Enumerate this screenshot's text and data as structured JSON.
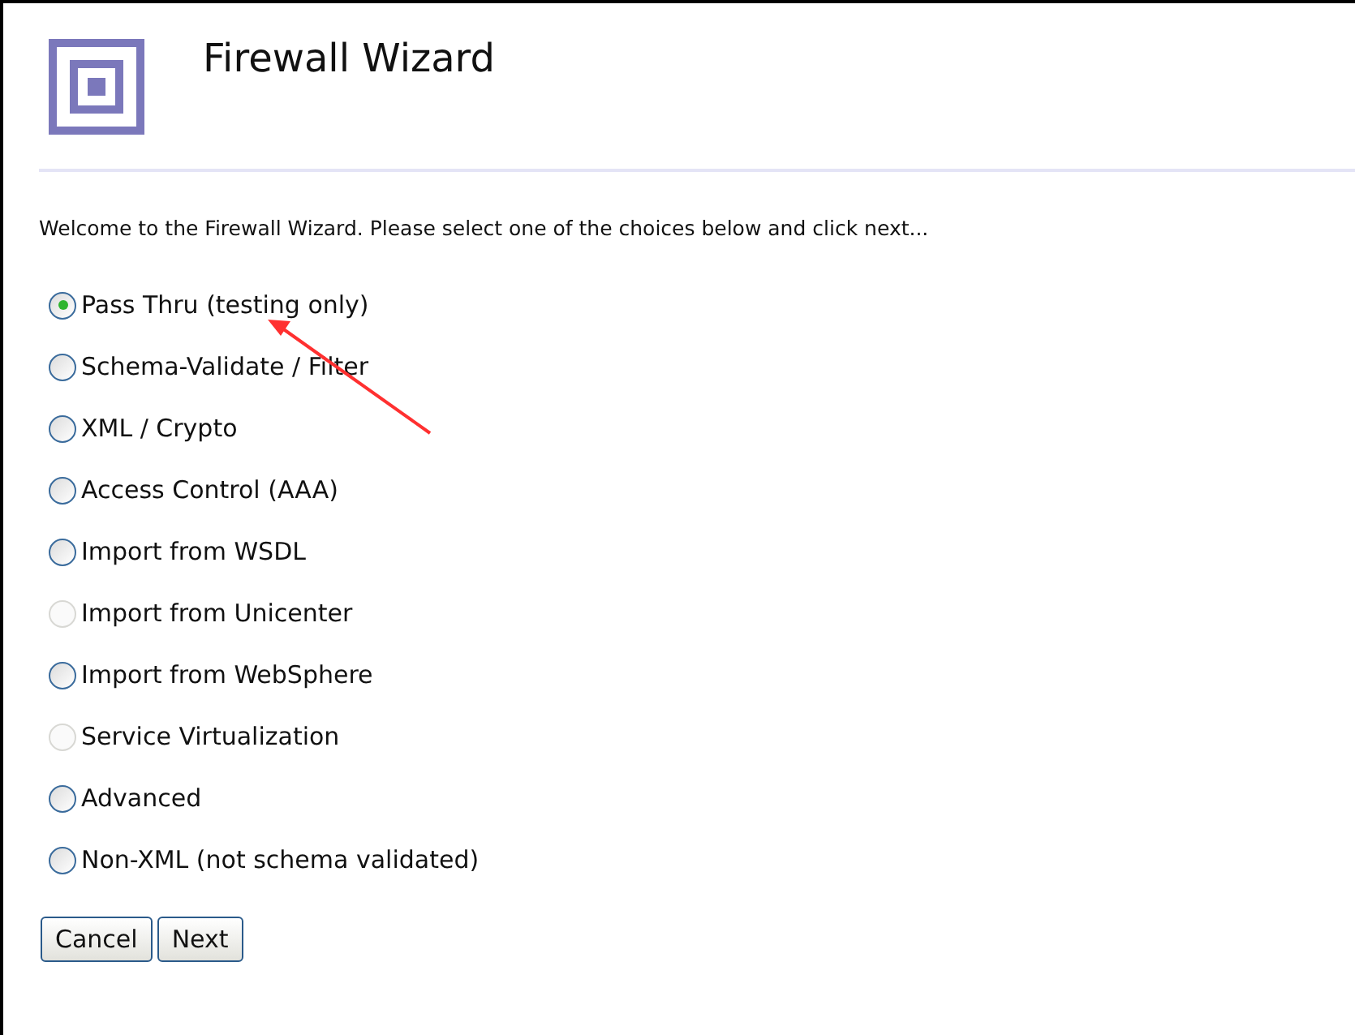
{
  "title": "Firewall Wizard",
  "intro": "Welcome to the Firewall Wizard. Please select one of the choices below and click next...",
  "choices": [
    {
      "label": "Pass Thru (testing only)",
      "selected": true,
      "disabled": false
    },
    {
      "label": "Schema-Validate / Filter",
      "selected": false,
      "disabled": false
    },
    {
      "label": "XML / Crypto",
      "selected": false,
      "disabled": false
    },
    {
      "label": "Access Control (AAA)",
      "selected": false,
      "disabled": false
    },
    {
      "label": "Import from WSDL",
      "selected": false,
      "disabled": false
    },
    {
      "label": "Import from Unicenter",
      "selected": false,
      "disabled": true
    },
    {
      "label": "Import from WebSphere",
      "selected": false,
      "disabled": false
    },
    {
      "label": "Service Virtualization",
      "selected": false,
      "disabled": true
    },
    {
      "label": "Advanced",
      "selected": false,
      "disabled": false
    },
    {
      "label": "Non-XML (not schema validated)",
      "selected": false,
      "disabled": false
    }
  ],
  "buttons": [
    "Cancel",
    "Next"
  ]
}
